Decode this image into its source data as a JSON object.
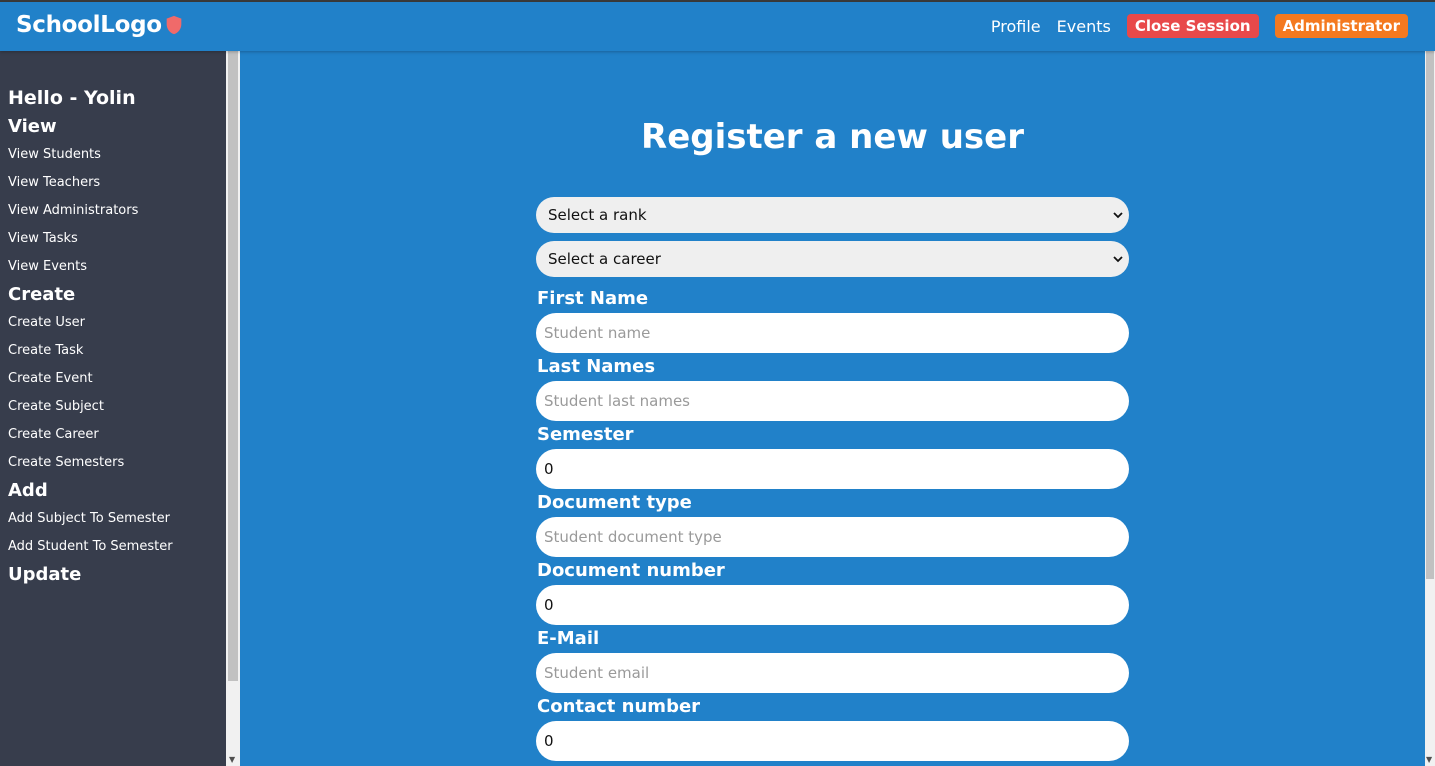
{
  "header": {
    "logo": "SchoolLogo",
    "nav": {
      "profile": "Profile",
      "events": "Events",
      "close_session": "Close Session",
      "administrator": "Administrator"
    }
  },
  "sidebar": {
    "greeting": "Hello - Yolin",
    "sections": {
      "view": "View",
      "create": "Create",
      "add": "Add",
      "update": "Update"
    },
    "view_items": [
      "View Students",
      "View Teachers",
      "View Administrators",
      "View Tasks",
      "View Events"
    ],
    "create_items": [
      "Create User",
      "Create Task",
      "Create Event",
      "Create Subject",
      "Create Career",
      "Create Semesters"
    ],
    "add_items": [
      "Add Subject To Semester",
      "Add Student To Semester"
    ]
  },
  "form": {
    "title": "Register a new user",
    "rank_select": "Select a rank",
    "career_select": "Select a career",
    "first_name": {
      "label": "First Name",
      "placeholder": "Student name"
    },
    "last_names": {
      "label": "Last Names",
      "placeholder": "Student last names"
    },
    "semester": {
      "label": "Semester",
      "value": "0"
    },
    "document_type": {
      "label": "Document type",
      "placeholder": "Student document type"
    },
    "document_number": {
      "label": "Document number",
      "value": "0"
    },
    "email": {
      "label": "E-Mail",
      "placeholder": "Student email"
    },
    "contact_number": {
      "label": "Contact number",
      "value": "0"
    }
  },
  "colors": {
    "primary": "#2181c9",
    "sidebar": "#373d4c",
    "close_session": "#e8494a",
    "administrator": "#f4791f"
  }
}
